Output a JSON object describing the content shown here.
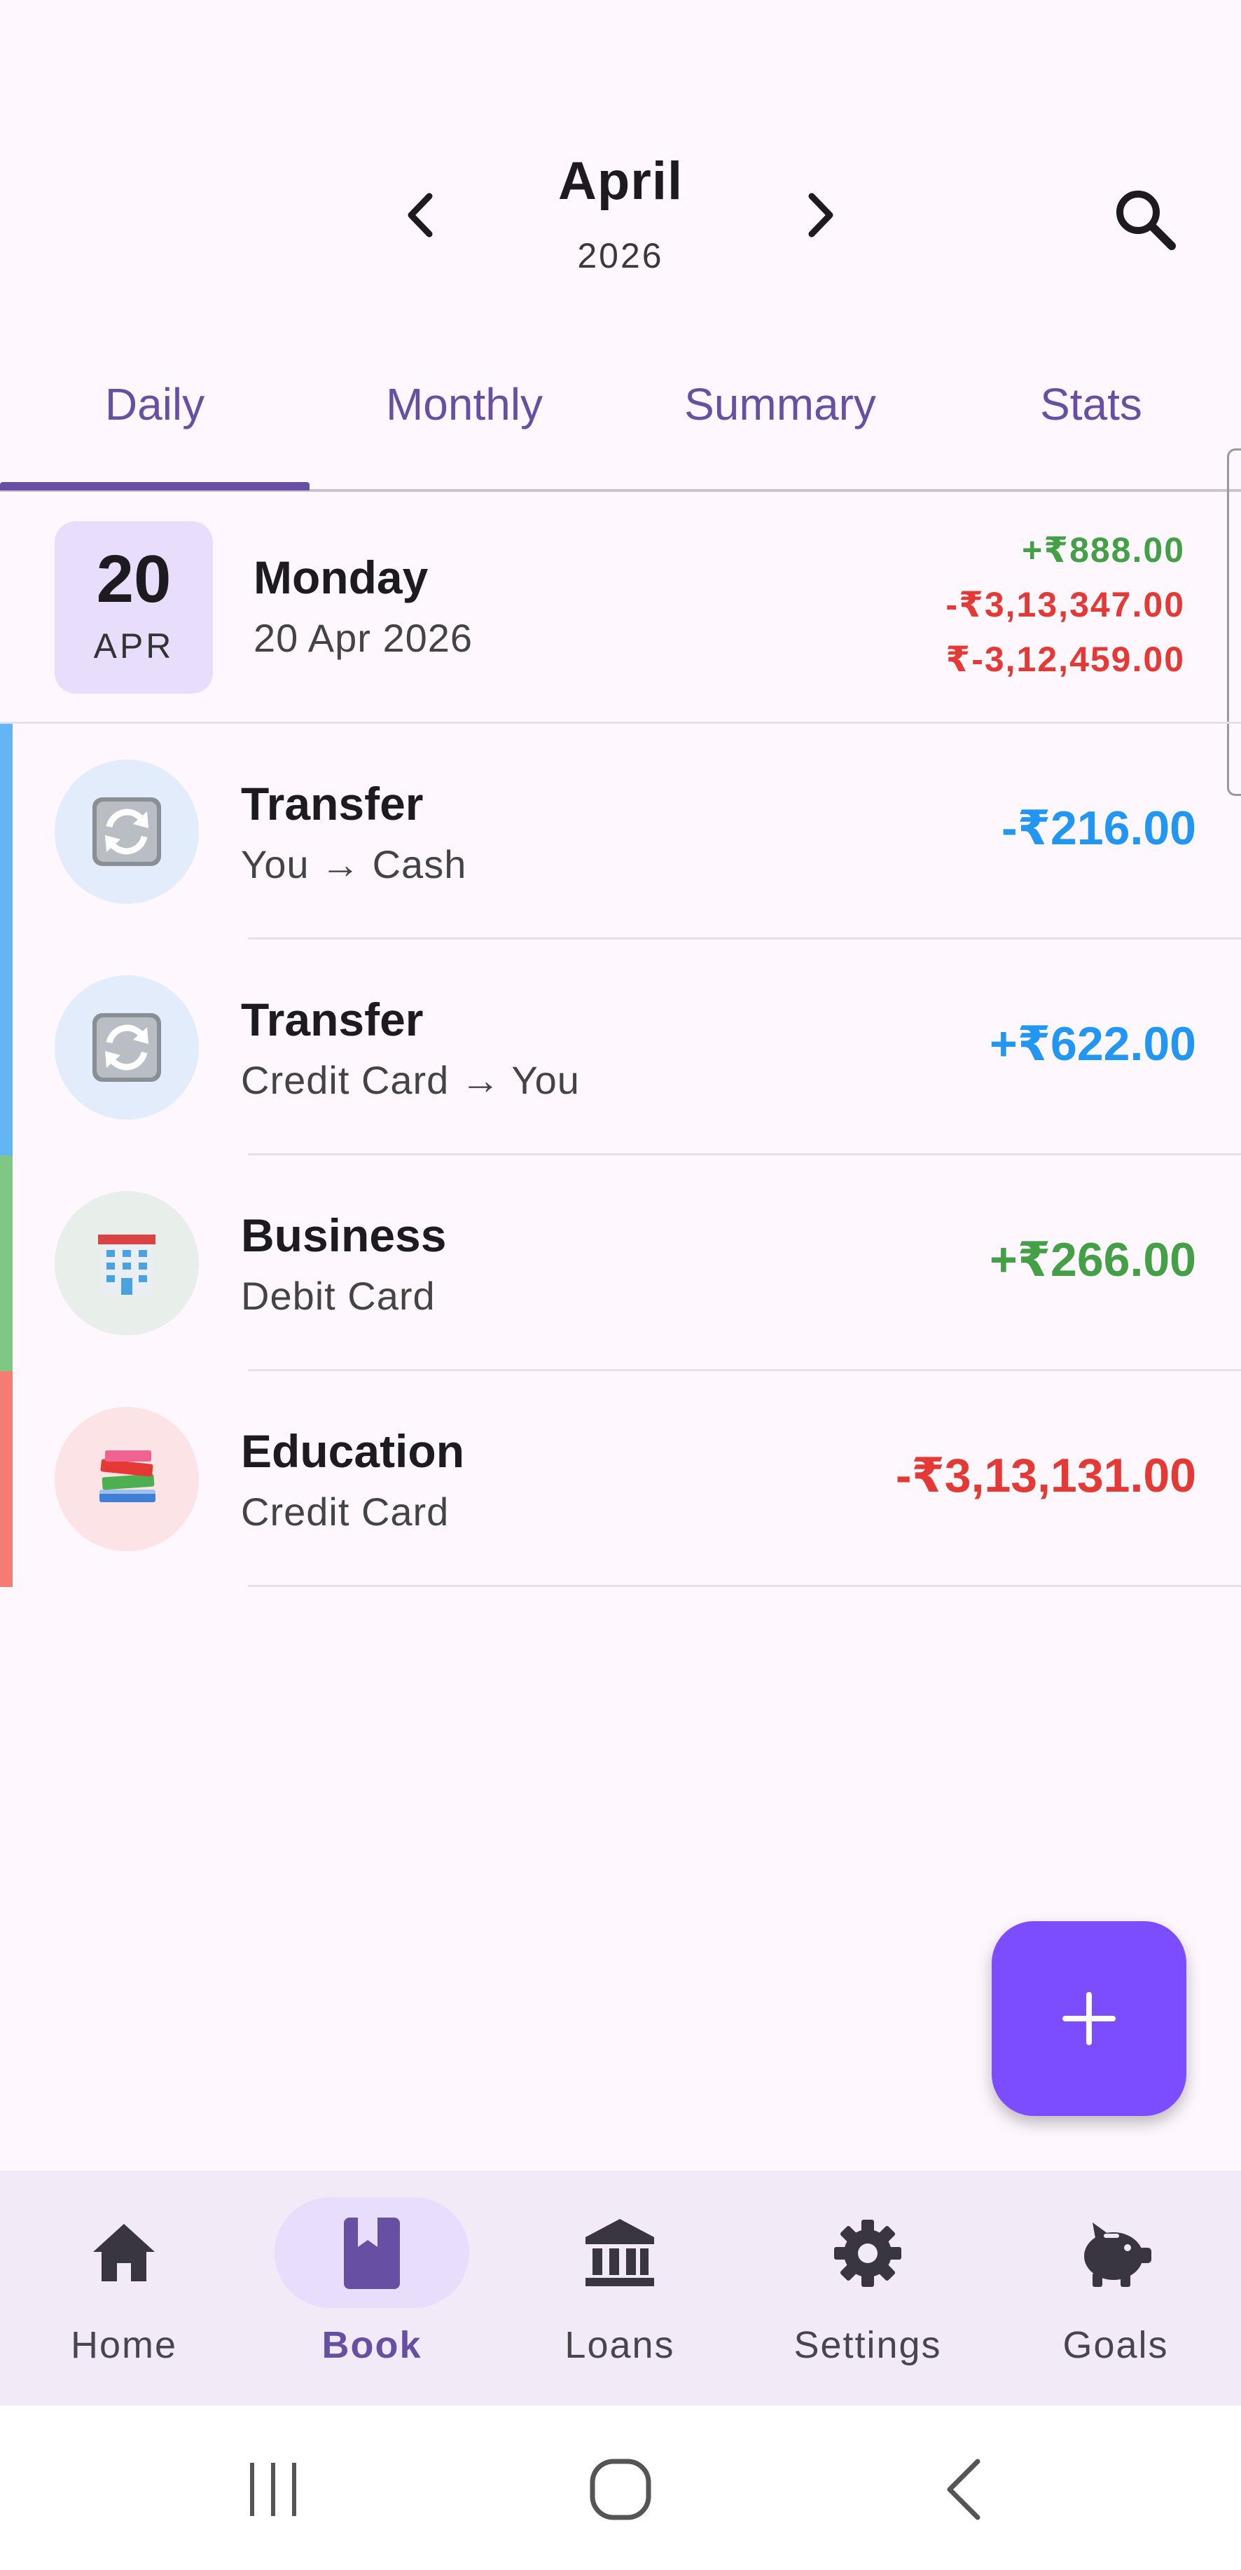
{
  "header": {
    "month": "April",
    "year": "2026"
  },
  "icons": {
    "prev": "chevron-left-icon",
    "next": "chevron-right-icon",
    "search": "search-icon",
    "transfer": "arrows-cycle-icon",
    "business": "office-building-icon",
    "education": "books-icon",
    "add": "plus-icon",
    "home": "home-icon",
    "book": "book-icon",
    "loans": "bank-icon",
    "settings": "gear-icon",
    "goals": "piggy-bank-icon"
  },
  "tabs": [
    {
      "label": "Daily",
      "active": true
    },
    {
      "label": "Monthly",
      "active": false
    },
    {
      "label": "Summary",
      "active": false
    },
    {
      "label": "Stats",
      "active": false
    }
  ],
  "day": {
    "day_num": "20",
    "month_abbr": "APR",
    "weekday": "Monday",
    "full_date": "20 Apr 2026",
    "income": "+₹888.00",
    "expense": "-₹3,13,347.00",
    "net": "₹-3,12,459.00"
  },
  "transactions": [
    {
      "title": "Transfer",
      "subtitle": "You → Cash",
      "amount": "-₹216.00",
      "color": "#2196f3"
    },
    {
      "title": "Transfer",
      "subtitle": "Credit Card → You",
      "amount": "+₹622.00",
      "color": "#2196f3"
    },
    {
      "title": "Business",
      "subtitle": "Debit Card",
      "amount": "+₹266.00",
      "color": "#43a047"
    },
    {
      "title": "Education",
      "subtitle": "Credit Card",
      "amount": "-₹3,13,131.00",
      "color": "#e53935"
    }
  ],
  "bottom_nav": [
    {
      "label": "Home",
      "active": false
    },
    {
      "label": "Book",
      "active": true
    },
    {
      "label": "Loans",
      "active": false
    },
    {
      "label": "Settings",
      "active": false
    },
    {
      "label": "Goals",
      "active": false
    }
  ],
  "colors": {
    "primary": "#6750a4",
    "fab": "#7c4dff",
    "income": "#43a047",
    "expense": "#e53935",
    "transfer": "#2196f3"
  }
}
